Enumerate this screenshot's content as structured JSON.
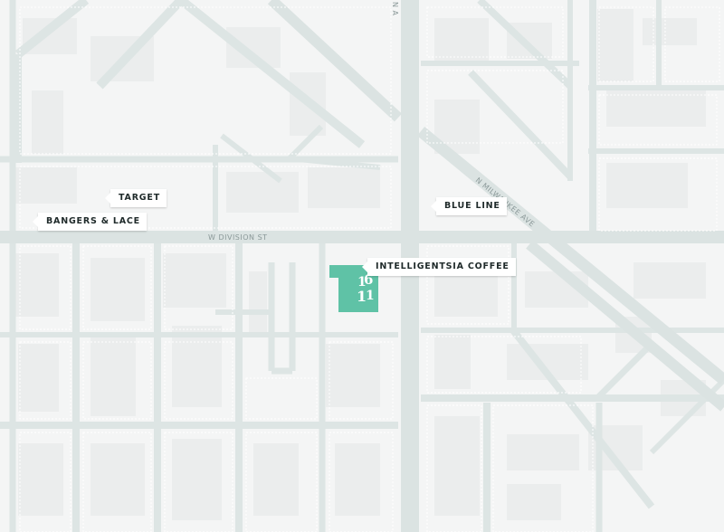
{
  "map": {
    "streets": {
      "division": "W DIVISION ST",
      "milwaukee": "N MILWAUKEE AVE",
      "north_vertical": "N A"
    },
    "pois": [
      {
        "id": "target",
        "label": "TARGET"
      },
      {
        "id": "bangers",
        "label": "BANGERS & LACE"
      },
      {
        "id": "blueline",
        "label": "BLUE LINE"
      },
      {
        "id": "intelligentsia",
        "label": "INTELLIGENTSIA COFFEE"
      }
    ],
    "marker": {
      "logo_top": "1",
      "logo_mid": "6",
      "logo_bottom": "1",
      "logo_right": "1",
      "color": "#5fc2a6"
    },
    "colors": {
      "background": "#f4f5f5",
      "road": "#dde5e4",
      "block": "#ebeded",
      "label_bg": "#ffffff"
    }
  }
}
